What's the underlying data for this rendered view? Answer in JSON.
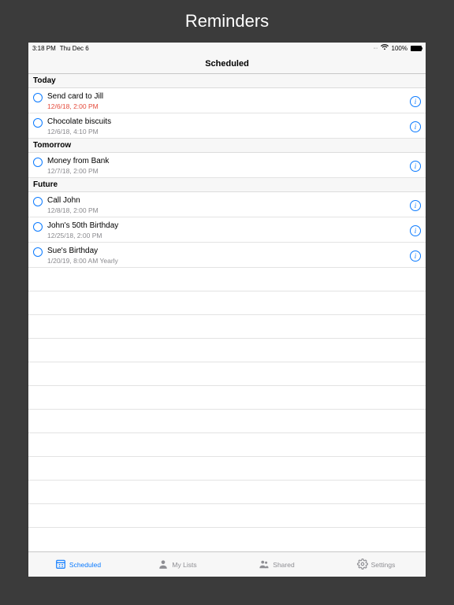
{
  "page_header": "Reminders",
  "statusbar": {
    "time": "3:18 PM",
    "date": "Thu Dec 6",
    "battery_pct": "100%"
  },
  "navbar": {
    "title": "Scheduled"
  },
  "sections": {
    "today": {
      "label": "Today",
      "items": [
        {
          "title": "Send card to Jill",
          "sub": "12/6/18, 2:00 PM",
          "overdue": true
        },
        {
          "title": "Chocolate biscuits",
          "sub": "12/6/18, 4:10 PM",
          "overdue": false
        }
      ]
    },
    "tomorrow": {
      "label": "Tomorrow",
      "items": [
        {
          "title": "Money from Bank",
          "sub": "12/7/18, 2:00 PM",
          "overdue": false
        }
      ]
    },
    "future": {
      "label": "Future",
      "items": [
        {
          "title": "Call John",
          "sub": "12/8/18, 2:00 PM",
          "overdue": false
        },
        {
          "title": "John's 50th Birthday",
          "sub": "12/25/18, 2:00 PM",
          "overdue": false
        },
        {
          "title": "Sue's Birthday",
          "sub": "1/20/19, 8:00 AM Yearly",
          "overdue": false
        }
      ]
    }
  },
  "info_glyph": "i",
  "tabs": {
    "scheduled": "Scheduled",
    "mylists": "My Lists",
    "shared": "Shared",
    "settings": "Settings"
  }
}
